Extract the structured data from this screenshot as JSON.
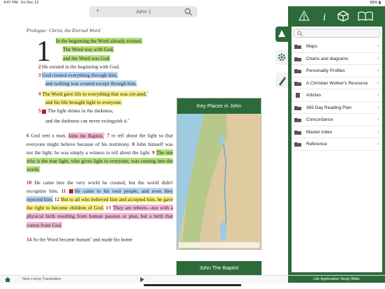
{
  "status": {
    "time": "4:47 PM",
    "date": "Fri Dec 13",
    "battery": "88%"
  },
  "header": {
    "title": "John 1",
    "back": "‹"
  },
  "reading": {
    "prologue": "Prologue: Christ, the Eternal Word",
    "drop_cap": "1",
    "v1a": "In the beginning the Word already existed.",
    "v1b": "The Word was with God,",
    "v1c": "and the Word was God.",
    "v2": "He existed in the beginning with God.",
    "v3a": "God created everything through him,",
    "v3b": "and nothing was created except through him.",
    "v4a": "The Word gave life to everything that was cre-ated,",
    "v4b": "and his life brought light to everyone.",
    "v5a": "The light shines in the darkness,",
    "v5b": "and the darkness can never extinguish it.",
    "p6": "God sent a man,",
    "p6hl": "John the Baptist,",
    "p6b": "to tell about the light so that everyone might believe because of his testimony.",
    "p8": "John himself was not the light; he was simply a witness to tell about the light.",
    "p9": "The one who is the true light, who gives light to everyone, was coming into the world.",
    "p10": "He came into the very world he created, but the world didn't recognize him.",
    "p11": "He came to his own people, and even they rejected him.",
    "p12": "But to all who believed him and accepted him, he gave the right to become children of God.",
    "p13": "They are reborn—not with a physical birth resulting from human passion or plan, but a birth that comes from God.",
    "p14": "So the Word became human",
    "p14b": "and made his home"
  },
  "map_card": {
    "title": "Key Places in John"
  },
  "baptist_card": {
    "title": "John The Baptist"
  },
  "bottom": {
    "translation": "New Living Translation",
    "bible": "Life Application Study Bible"
  },
  "sidebar": {
    "search_placeholder": "",
    "items": [
      {
        "label": "Maps"
      },
      {
        "label": "Charts and diagrams"
      },
      {
        "label": "Personality Profiles"
      },
      {
        "label": "A Christian Worker's Resource"
      },
      {
        "label": "Articles"
      },
      {
        "label": "365 Day Reading Plan"
      },
      {
        "label": "Concordance"
      },
      {
        "label": "Master index"
      },
      {
        "label": "Reference"
      }
    ]
  },
  "colors": {
    "brand": "#2d6a3a",
    "highlight_green": "#b5e07a",
    "highlight_blue": "#b8d5f2",
    "highlight_yellow": "#f8f07a",
    "highlight_pink": "#f5b8d4"
  },
  "icons": {
    "panel": [
      "tree-icon",
      "info-icon",
      "cube-icon",
      "book-icon"
    ],
    "sidetabs": [
      "tree-icon",
      "gear-icon",
      "pencil-icon"
    ]
  }
}
